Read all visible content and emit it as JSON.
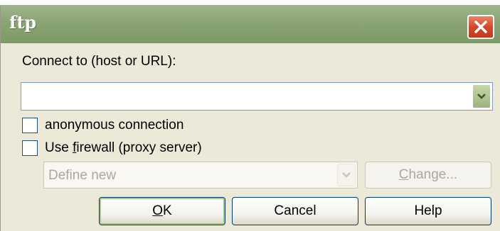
{
  "window": {
    "title": "ftp",
    "close_icon": "close-icon"
  },
  "connect": {
    "label": "Connect to (host or URL):",
    "host_value": ""
  },
  "options": {
    "anonymous_label": "anonymous connection",
    "anonymous_checked": false,
    "firewall_label_pre": "Use ",
    "firewall_label_ul": "f",
    "firewall_label_post": "irewall (proxy server)",
    "firewall_checked": false
  },
  "proxy": {
    "selected": "Define new",
    "change_label_ul": "C",
    "change_label_post": "hange..."
  },
  "buttons": {
    "ok_ul": "O",
    "ok_post": "K",
    "cancel": "Cancel",
    "help": "Help"
  },
  "colors": {
    "titlebar": "#8AA474",
    "dialog_bg": "#ECE9D8",
    "close_button": "#D4492A"
  }
}
